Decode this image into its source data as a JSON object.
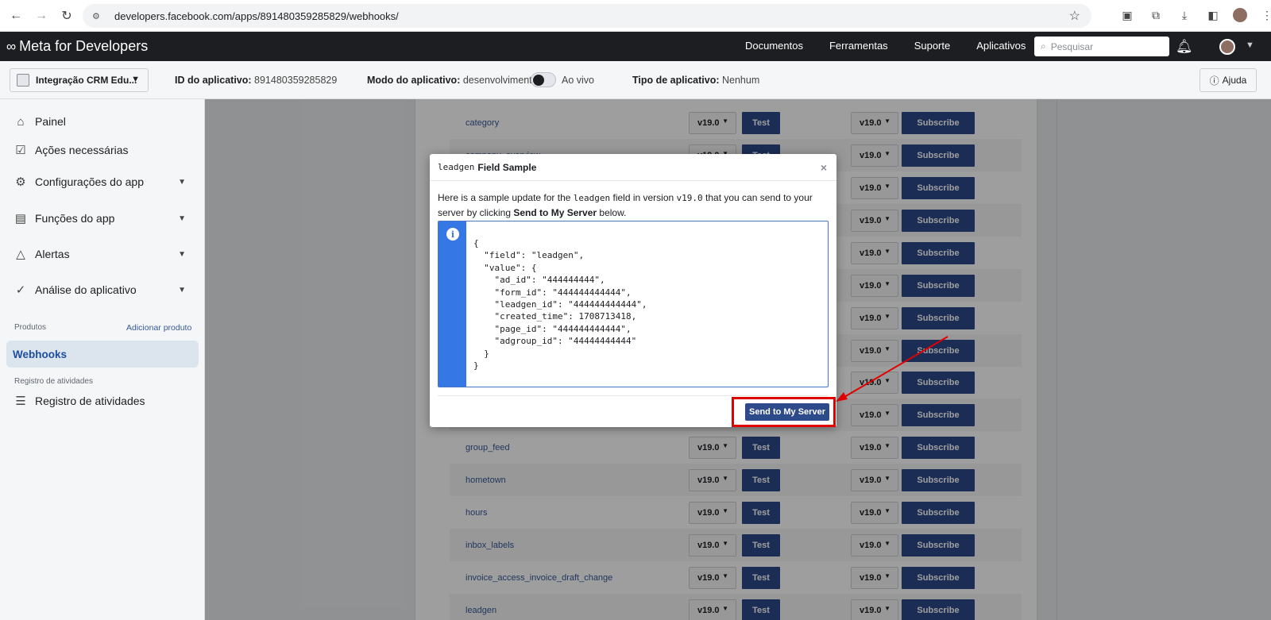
{
  "browser": {
    "url": "developers.facebook.com/apps/891480359285829/webhooks/"
  },
  "topnav": {
    "brand": "Meta for Developers",
    "links": [
      "Documentos",
      "Ferramentas",
      "Suporte",
      "Aplicativos"
    ],
    "search_placeholder": "Pesquisar"
  },
  "appbar": {
    "app_name": "Integração CRM Edu...",
    "app_id_label": "ID do aplicativo:",
    "app_id_value": "891480359285829",
    "mode_label": "Modo do aplicativo:",
    "mode_value": "desenvolvimento",
    "live_label": "Ao vivo",
    "type_label": "Tipo de aplicativo:",
    "type_value": "Nenhum",
    "help_label": "Ajuda"
  },
  "sidebar": {
    "items": [
      {
        "label": "Painel",
        "icon": "home-icon"
      },
      {
        "label": "Ações necessárias",
        "icon": "checklist-icon"
      },
      {
        "label": "Configurações do app",
        "icon": "gear-icon"
      },
      {
        "label": "Funções do app",
        "icon": "roles-icon"
      },
      {
        "label": "Alertas",
        "icon": "bell-icon"
      },
      {
        "label": "Análise do aplicativo",
        "icon": "shield-check-icon"
      }
    ],
    "products_label": "Produtos",
    "add_product": "Adicionar produto",
    "active_item": "Webhooks",
    "activity_section": "Registro de atividades",
    "activity_item": "Registro de atividades"
  },
  "fields": {
    "version": "v19.0",
    "test_label": "Test",
    "subscribe_label": "Subscribe",
    "rows": [
      "category",
      "company_overview",
      "",
      "",
      "",
      "",
      "",
      "",
      "",
      "",
      "group_feed",
      "hometown",
      "hours",
      "inbox_labels",
      "invoice_access_invoice_draft_change",
      "leadgen"
    ]
  },
  "modal": {
    "title_mono": "leadgen",
    "title_rest": "Field Sample",
    "close": "×",
    "desc_1": "Here is a sample update for the",
    "desc_field": "leadgen",
    "desc_2": "field in version",
    "desc_version": "v19.0",
    "desc_3": "that you can send to your server by clicking",
    "desc_bold": "Send to My Server",
    "desc_4": "below.",
    "code": "{\n  \"field\": \"leadgen\",\n  \"value\": {\n    \"ad_id\": \"444444444\",\n    \"form_id\": \"444444444444\",\n    \"leadgen_id\": \"444444444444\",\n    \"created_time\": 1708713418,\n    \"page_id\": \"444444444444\",\n    \"adgroup_id\": \"44444444444\"\n  }\n}",
    "send_button": "Send to My Server"
  },
  "colors": {
    "primary_button": "#2d4a8a",
    "annotation": "#e10000",
    "info_gutter": "#3578e5"
  }
}
